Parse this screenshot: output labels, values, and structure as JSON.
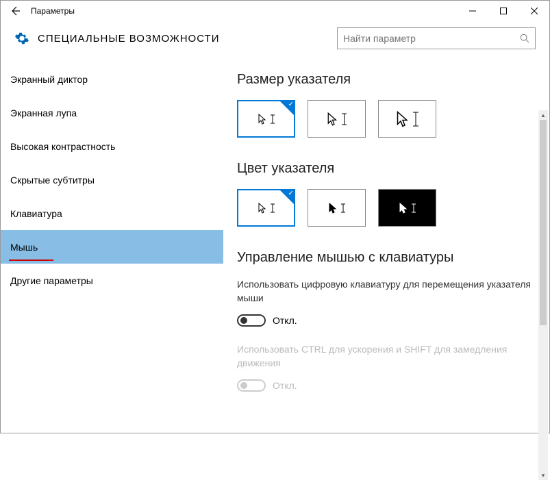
{
  "window": {
    "title": "Параметры"
  },
  "header": {
    "title": "СПЕЦИАЛЬНЫЕ ВОЗМОЖНОСТИ"
  },
  "search": {
    "placeholder": "Найти параметр"
  },
  "sidebar": {
    "items": [
      {
        "label": "Экранный диктор"
      },
      {
        "label": "Экранная лупа"
      },
      {
        "label": "Высокая контрастность"
      },
      {
        "label": "Скрытые субтитры"
      },
      {
        "label": "Клавиатура"
      },
      {
        "label": "Мышь"
      },
      {
        "label": "Другие параметры"
      }
    ]
  },
  "main": {
    "pointer_size_title": "Размер указателя",
    "pointer_color_title": "Цвет указателя",
    "keyboard_mouse_title": "Управление мышью с клавиатуры",
    "numpad_desc": "Использовать цифровую клавиатуру для перемещения указателя мыши",
    "numpad_toggle": "Откл.",
    "ctrl_desc": "Использовать CTRL для ускорения и SHIFT для замедления движения",
    "ctrl_toggle": "Откл."
  }
}
